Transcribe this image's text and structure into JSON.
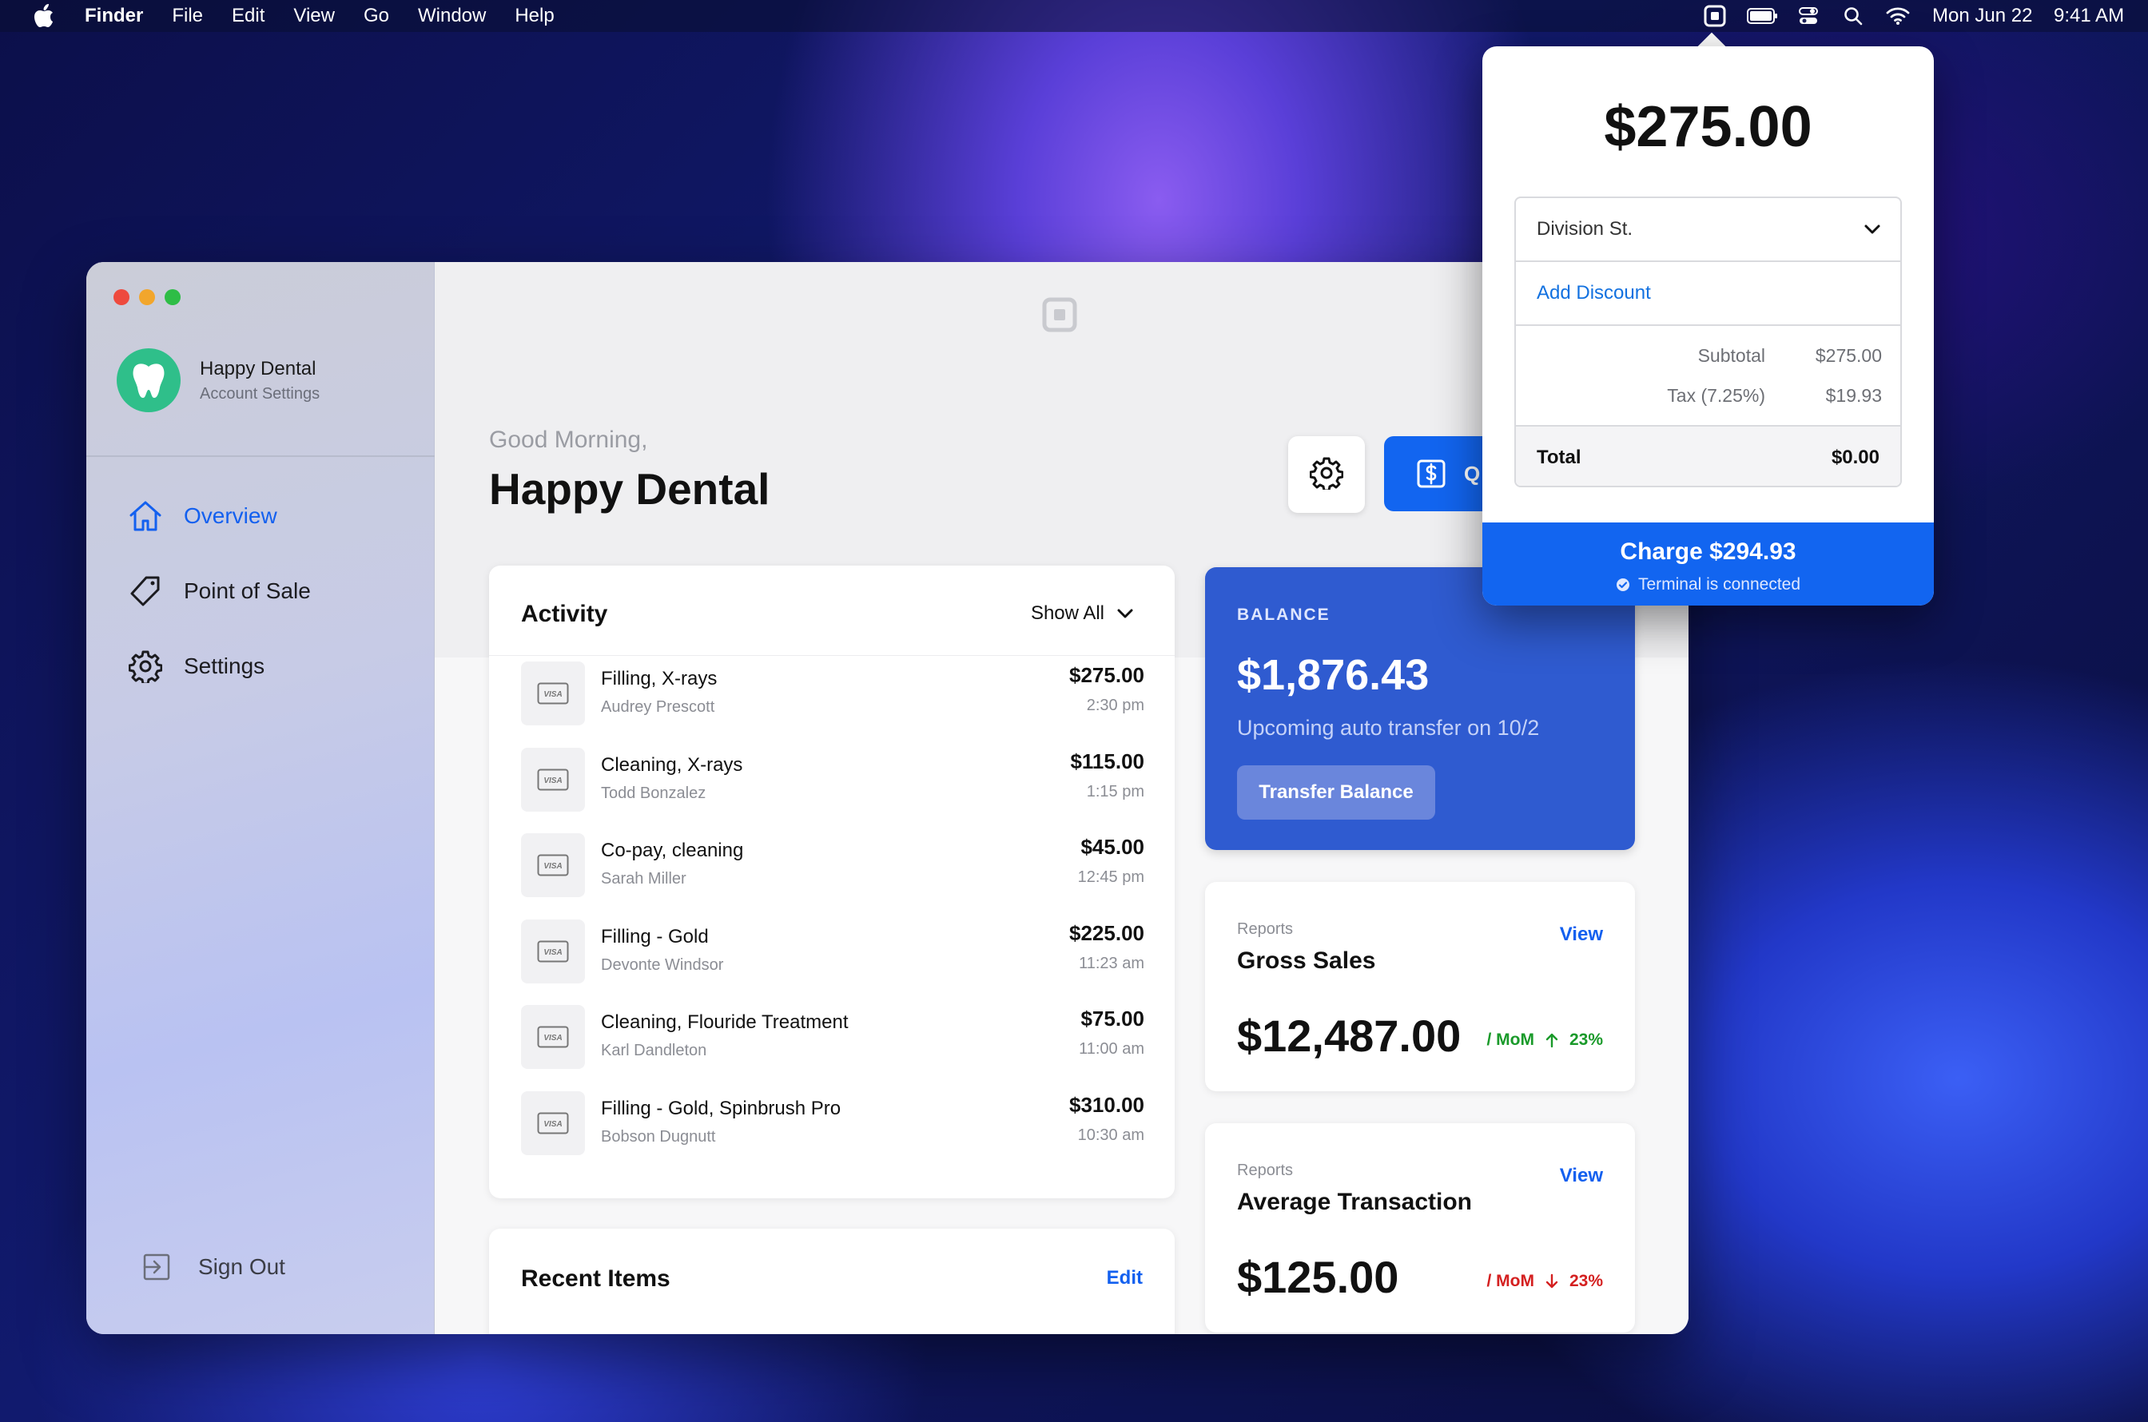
{
  "menubar": {
    "app": "Finder",
    "items": [
      "File",
      "Edit",
      "View",
      "Go",
      "Window",
      "Help"
    ],
    "date": "Mon Jun 22",
    "time": "9:41 AM",
    "status_icons": [
      "square-app-icon",
      "battery-icon",
      "control-center-icon",
      "search-icon",
      "wifi-icon"
    ]
  },
  "sidebar": {
    "account_name": "Happy Dental",
    "account_sub": "Account Settings",
    "nav": [
      {
        "label": "Overview",
        "icon": "home-icon",
        "active": true
      },
      {
        "label": "Point of Sale",
        "icon": "tag-icon",
        "active": false
      },
      {
        "label": "Settings",
        "icon": "gear-icon",
        "active": false
      }
    ],
    "sign_out": "Sign Out"
  },
  "header": {
    "greeting": "Good Morning,",
    "title": "Happy Dental",
    "quick_btn_initial": "Q"
  },
  "activity": {
    "title": "Activity",
    "filter": "Show All",
    "rows": [
      {
        "desc": "Filling, X-rays",
        "who": "Audrey Prescott",
        "amount": "$275.00",
        "time": "2:30 pm"
      },
      {
        "desc": "Cleaning, X-rays",
        "who": "Todd Bonzalez",
        "amount": "$115.00",
        "time": "1:15 pm"
      },
      {
        "desc": "Co-pay, cleaning",
        "who": "Sarah Miller",
        "amount": "$45.00",
        "time": "12:45 pm"
      },
      {
        "desc": "Filling - Gold",
        "who": "Devonte Windsor",
        "amount": "$225.00",
        "time": "11:23 am"
      },
      {
        "desc": "Cleaning, Flouride Treatment",
        "who": "Karl Dandleton",
        "amount": "$75.00",
        "time": "11:00 am"
      },
      {
        "desc": "Filling - Gold, Spinbrush Pro",
        "who": "Bobson Dugnutt",
        "amount": "$310.00",
        "time": "10:30 am"
      }
    ],
    "card_label": "VISA"
  },
  "recent": {
    "title": "Recent Items",
    "edit": "Edit"
  },
  "balance": {
    "label": "BALANCE",
    "value": "$1,876.43",
    "note": "Upcoming auto transfer on 10/2",
    "button": "Transfer Balance"
  },
  "reports": [
    {
      "small": "Reports",
      "name": "Gross Sales",
      "view": "View",
      "value": "$12,487.00",
      "trend_label": "/ MoM",
      "trend_dir": "up",
      "trend_pct": "23%",
      "color": "#1a9a2a"
    },
    {
      "small": "Reports",
      "name": "Average Transaction",
      "view": "View",
      "value": "$125.00",
      "trend_label": "/ MoM",
      "trend_dir": "down",
      "trend_pct": "23%",
      "color": "#d42020"
    }
  ],
  "popover": {
    "amount": "$275.00",
    "location": "Division St.",
    "add_discount": "Add Discount",
    "subtotal_label": "Subtotal",
    "subtotal_value": "$275.00",
    "tax_label": "Tax (7.25%)",
    "tax_value": "$19.93",
    "total_label": "Total",
    "total_value": "$0.00",
    "charge": "Charge $294.93",
    "status": "Terminal is connected"
  },
  "colors": {
    "accent": "#1265f0",
    "balance": "#2f5bd0",
    "logo": "#2fbf8a"
  }
}
